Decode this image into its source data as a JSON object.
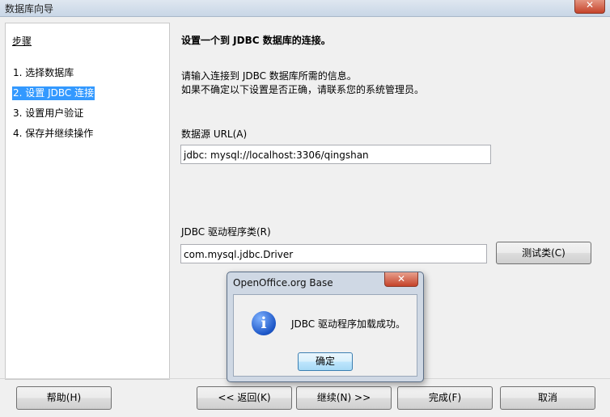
{
  "window": {
    "title": "数据库向导",
    "close_glyph": "✕"
  },
  "steps": {
    "heading": "步骤",
    "items": [
      {
        "label": "1. 选择数据库"
      },
      {
        "label": "2. 设置 JDBC 连接"
      },
      {
        "label": "3. 设置用户验证"
      },
      {
        "label": "4. 保存并继续操作"
      }
    ]
  },
  "main": {
    "title": "设置一个到 JDBC 数据库的连接。",
    "description_line1": "请输入连接到 JDBC 数据库所需的信息。",
    "description_line2": "如果不确定以下设置是否正确，请联系您的系统管理员。",
    "url_label": "数据源 URL(A)",
    "url_prefix": "jdbc:",
    "url_value": "mysql://localhost:3306/qingshan",
    "driver_label": "JDBC 驱动程序类(R)",
    "driver_value": "com.mysql.jdbc.Driver",
    "test_button": "测试类(C)"
  },
  "footer": {
    "help": "帮助(H)",
    "back": "<< 返回(K)",
    "next": "继续(N) >>",
    "finish": "完成(F)",
    "cancel": "取消"
  },
  "dialog": {
    "title": "OpenOffice.org Base",
    "close_glyph": "✕",
    "icon_glyph": "i",
    "message": "JDBC 驱动程序加载成功。",
    "ok": "确定"
  }
}
